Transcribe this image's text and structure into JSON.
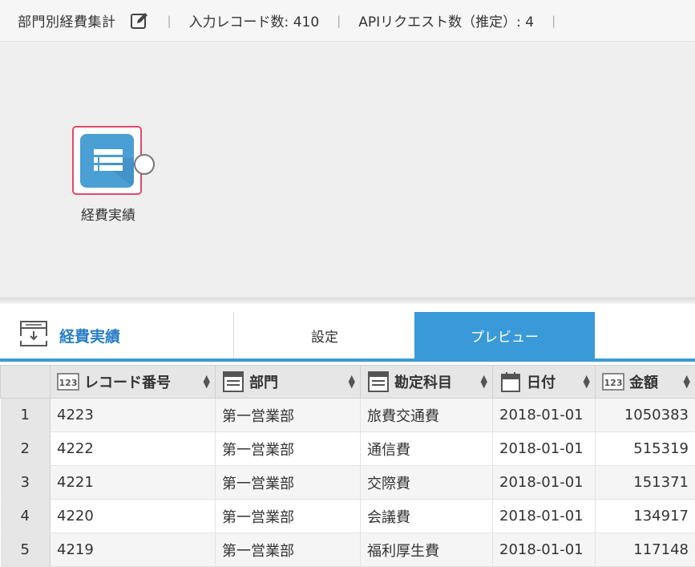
{
  "header": {
    "title": "部門別経費集計",
    "record_count": "入力レコード数: 410",
    "api_count": "APIリクエスト数（推定）: 4",
    "separator": "|"
  },
  "canvas": {
    "node_label": "経費実績"
  },
  "panel": {
    "title": "経費実績",
    "tabs": [
      {
        "label": "設定",
        "active": false
      },
      {
        "label": "プレビュー",
        "active": true
      }
    ],
    "accent_color": "#3a9ad9"
  },
  "table": {
    "columns": [
      {
        "label": "レコード番号",
        "type_icon": "number-type-icon"
      },
      {
        "label": "部門",
        "type_icon": "text-type-icon"
      },
      {
        "label": "勘定科目",
        "type_icon": "text-type-icon"
      },
      {
        "label": "日付",
        "type_icon": "calendar-type-icon"
      },
      {
        "label": "金額",
        "type_icon": "number-type-icon"
      }
    ],
    "rows": [
      {
        "n": "1",
        "cells": [
          "4223",
          "第一営業部",
          "旅費交通費",
          "2018-01-01",
          "1050383"
        ]
      },
      {
        "n": "2",
        "cells": [
          "4222",
          "第一営業部",
          "通信費",
          "2018-01-01",
          "515319"
        ]
      },
      {
        "n": "3",
        "cells": [
          "4221",
          "第一営業部",
          "交際費",
          "2018-01-01",
          "151371"
        ]
      },
      {
        "n": "4",
        "cells": [
          "4220",
          "第一営業部",
          "会議費",
          "2018-01-01",
          "134917"
        ]
      },
      {
        "n": "5",
        "cells": [
          "4219",
          "第一営業部",
          "福利厚生費",
          "2018-01-01",
          "117148"
        ]
      }
    ]
  }
}
